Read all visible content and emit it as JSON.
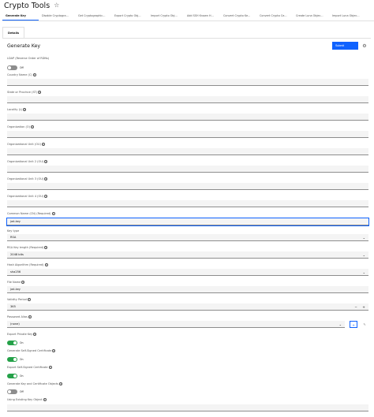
{
  "page": {
    "title": "Crypto Tools"
  },
  "tabs": [
    "Generate Key",
    "Disable Cryptogra...",
    "Get Cryptographic...",
    "Export Crypto Obj...",
    "Import Crypto Obj...",
    "Add SSH Known H...",
    "Convert Crypto Ke...",
    "Convert Crypto Ce...",
    "Create Luna Objec...",
    "Import Luna Objec..."
  ],
  "subtabs": [
    "Details"
  ],
  "form": {
    "title": "Generate Key",
    "submit_label": "Submit",
    "ldap_label": "LDAP (Reverse Order of RDNs)",
    "ldap_state": "Off",
    "country_label": "Country Name (C)",
    "state_label": "State or Province (ST)",
    "locality_label": "Locality (L)",
    "org_label": "Organization (O)",
    "ou1_label": "Organizational Unit (OU)",
    "ou2_label": "Organizational Unit 2 (OU)",
    "ou3_label": "Organizational Unit 3 (OU)",
    "ou4_label": "Organizational Unit 4 (OU)",
    "cn_label": "Common Name (CN) (Required)",
    "cn_value": "jwt-key",
    "keytype_label": "Key type",
    "keytype_value": "RSA",
    "keylength_label": "RSA Key length (Required)",
    "keylength_value": "2048 bits",
    "hash_label": "Hash Algorithm (Required)",
    "hash_value": "sha256",
    "filename_label": "File Name",
    "filename_value": "jwt-key",
    "validity_label": "Validity Period",
    "validity_value": "365",
    "minus_label": "−",
    "plus_label": "+",
    "password_label": "Password Alias",
    "password_value": "(none)",
    "export_private_label": "Export Private Key",
    "export_private_state": "On",
    "gen_selfsigned_label": "Generate Self-Signed Certificate",
    "gen_selfsigned_state": "On",
    "export_selfsigned_label": "Export Self-Signed Certificate",
    "export_selfsigned_state": "On",
    "gen_objects_label": "Generate Key and Certificate Objects",
    "gen_objects_state": "Off",
    "existing_label": "Using Existing Key Object"
  },
  "icons": {
    "info": "i",
    "chevron": "⌄",
    "star": "☆",
    "settings": "⚙",
    "add": "+",
    "edit": "✎"
  }
}
